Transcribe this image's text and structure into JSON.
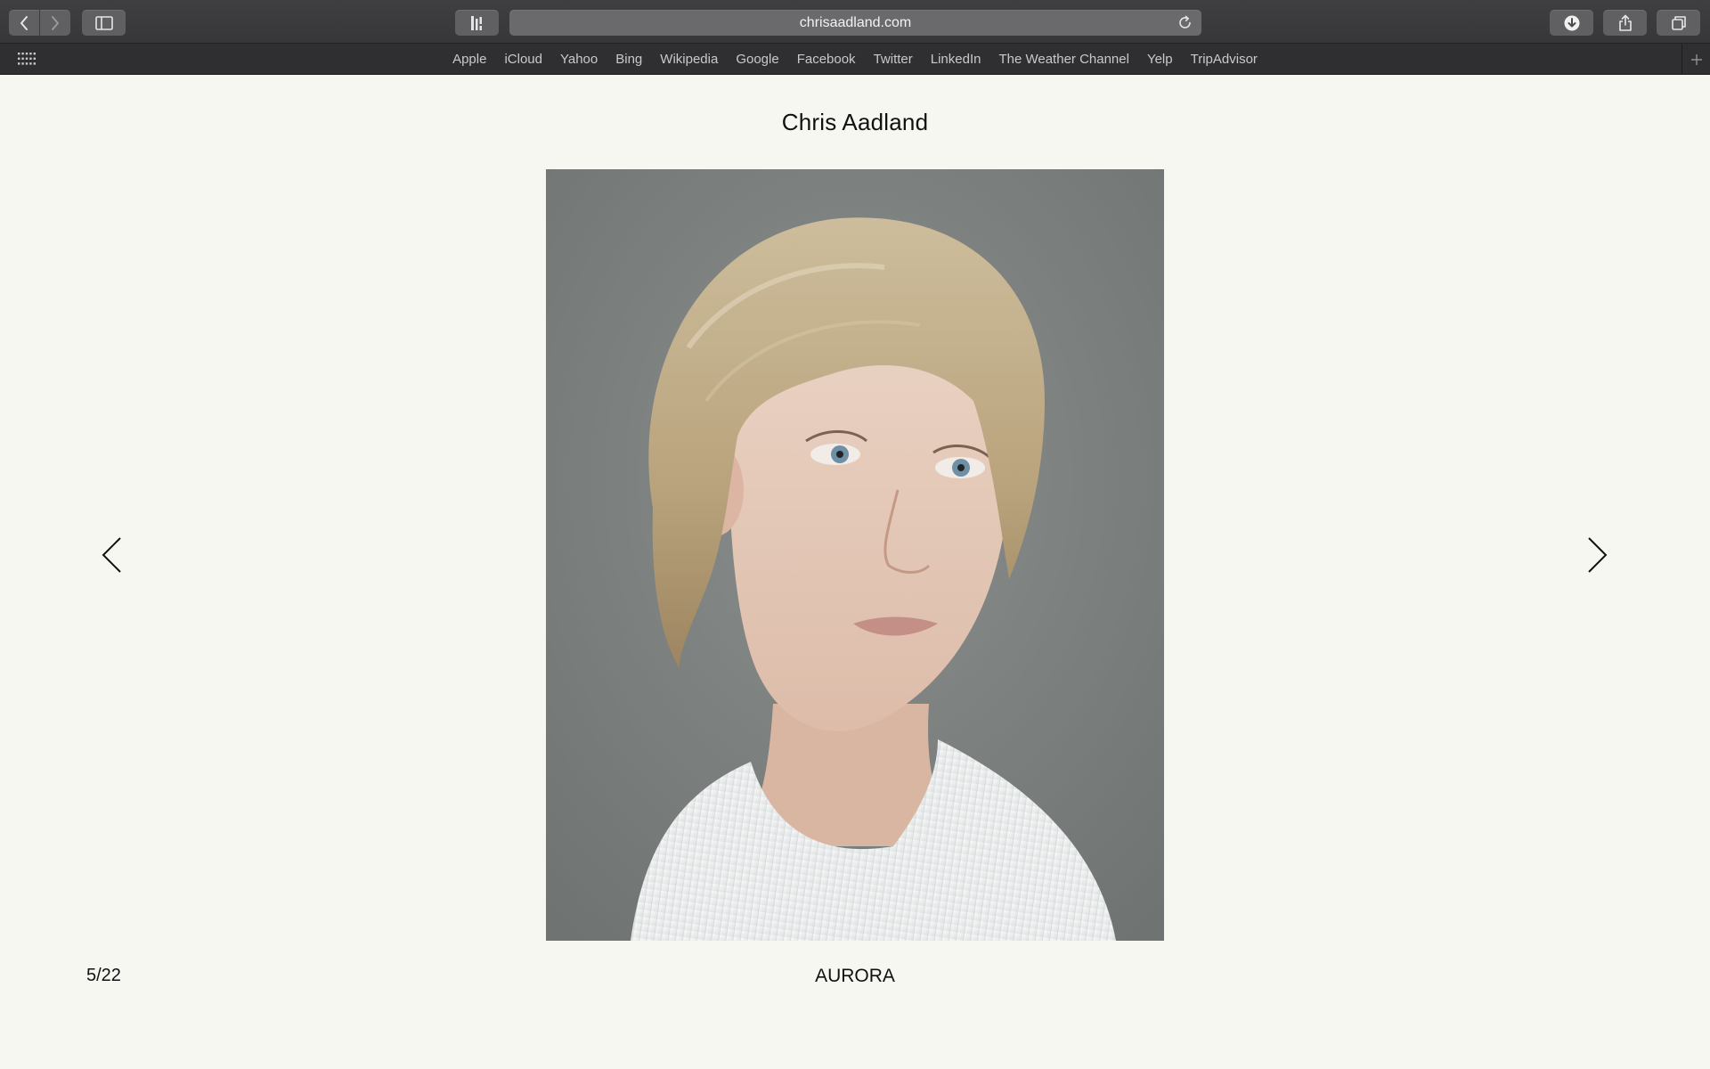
{
  "browser": {
    "url": "chrisaadland.com",
    "favorites": [
      "Apple",
      "iCloud",
      "Yahoo",
      "Bing",
      "Wikipedia",
      "Google",
      "Facebook",
      "Twitter",
      "LinkedIn",
      "The Weather Channel",
      "Yelp",
      "TripAdvisor"
    ],
    "icons": {
      "back": "chevron-left-icon",
      "forward": "chevron-right-icon",
      "sidebar": "sidebar-icon",
      "reader": "reader-icon",
      "reload": "reload-icon",
      "downloads": "download-icon",
      "share": "share-icon",
      "tabs": "tabs-overview-icon",
      "favorites_grid": "grid-icon",
      "new_tab": "plus-icon"
    }
  },
  "page": {
    "site_title": "Chris Aadland",
    "counter": "5/22",
    "caption": "AURORA",
    "colors": {
      "background": "#f7f7f2",
      "text": "#111111"
    }
  }
}
